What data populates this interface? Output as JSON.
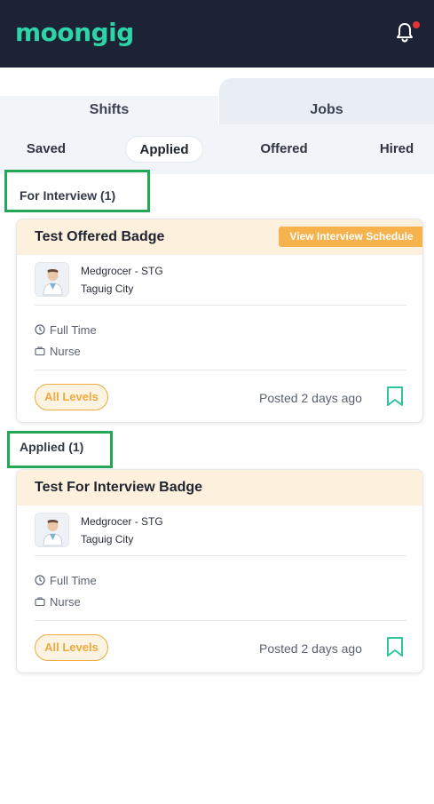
{
  "header": {
    "logo_text": "moongig",
    "notification_icon": "bell-icon",
    "has_unread": true
  },
  "tabs": [
    {
      "label": "Shifts",
      "selected": false
    },
    {
      "label": "Jobs",
      "selected": true
    }
  ],
  "subtabs": [
    {
      "label": "Saved",
      "selected": false
    },
    {
      "label": "Applied",
      "selected": true
    },
    {
      "label": "Offered",
      "selected": false
    },
    {
      "label": "Hired",
      "selected": false
    }
  ],
  "sections": [
    {
      "title": "For Interview (1)",
      "card": {
        "title": "Test Offered Badge",
        "action_label": "View Interview Schedule",
        "company": "Medgrocer - STG",
        "location": "Taguig City",
        "employment_type": "Full Time",
        "role": "Nurse",
        "level": "All Levels",
        "posted": "Posted 2 days ago"
      }
    },
    {
      "title": "Applied (1)",
      "card": {
        "title": "Test For Interview Badge",
        "company": "Medgrocer - STG",
        "location": "Taguig City",
        "employment_type": "Full Time",
        "role": "Nurse",
        "level": "All Levels",
        "posted": "Posted 2 days ago"
      }
    }
  ],
  "colors": {
    "header_bg": "#1b2335",
    "brand": "#2ed3a7",
    "card_head_bg": "#fdf1de",
    "badge_orange": "#f0a93c",
    "bookmark": "#2ec4a0",
    "highlight_box": "#25a855"
  }
}
